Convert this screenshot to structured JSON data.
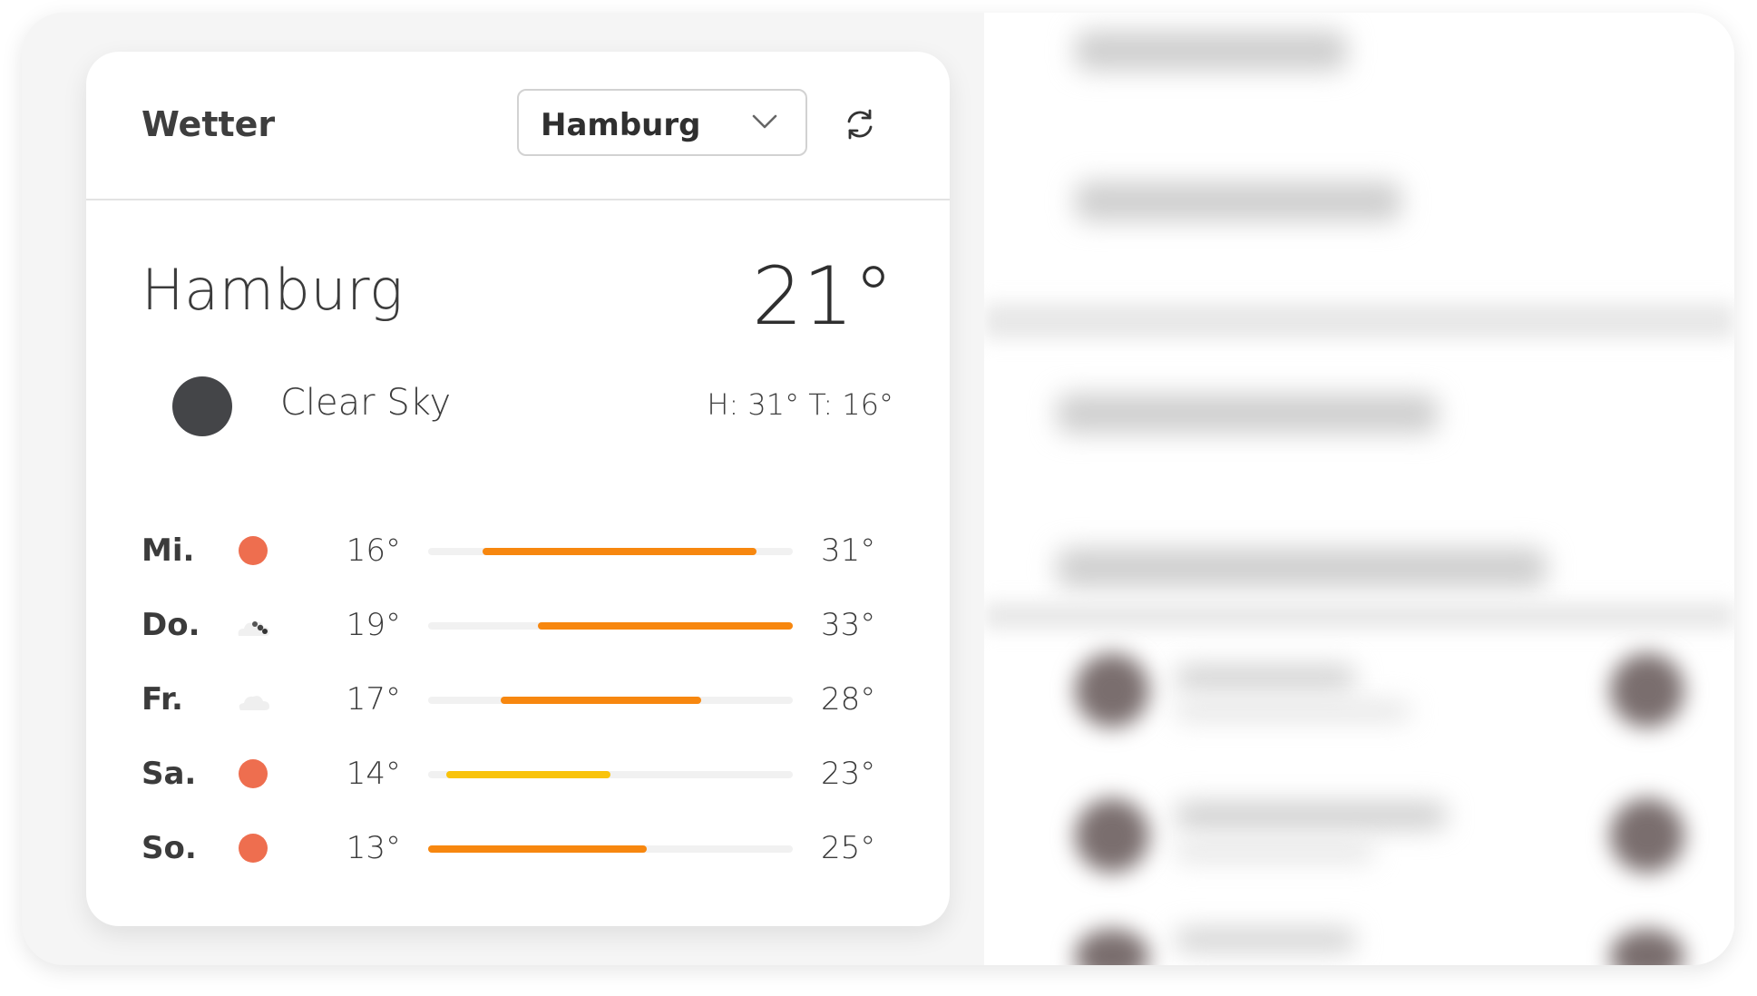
{
  "card": {
    "title": "Wetter",
    "select": {
      "value": "Hamburg"
    },
    "icons": {
      "dropdown": "chevron-down-icon",
      "refresh": "refresh-icon"
    }
  },
  "current": {
    "city": "Hamburg",
    "temperature": "21°",
    "condition": "Clear Sky",
    "condition_icon": "clear-sky-icon",
    "high_low": "H: 31° T: 16°"
  },
  "forecast": [
    {
      "day": "Mi.",
      "icon": "sun-icon",
      "low": "16°",
      "high": "31°",
      "bar_start": 0.15,
      "bar_end": 0.9,
      "bar_color": "#f7870f"
    },
    {
      "day": "Do.",
      "icon": "cloudy-icon",
      "low": "19°",
      "high": "33°",
      "bar_start": 0.3,
      "bar_end": 1.0,
      "bar_color": "#f7870f"
    },
    {
      "day": "Fr.",
      "icon": "cloud-icon",
      "low": "17°",
      "high": "28°",
      "bar_start": 0.2,
      "bar_end": 0.75,
      "bar_color": "#f7870f"
    },
    {
      "day": "Sa.",
      "icon": "sun-icon",
      "low": "14°",
      "high": "23°",
      "bar_start": 0.05,
      "bar_end": 0.5,
      "bar_color": "#f9c30b"
    },
    {
      "day": "So.",
      "icon": "sun-icon",
      "low": "13°",
      "high": "25°",
      "bar_start": 0.0,
      "bar_end": 0.6,
      "bar_color": "#f7870f"
    }
  ],
  "colors": {
    "accent_orange": "#f7870f",
    "accent_yellow": "#f9c30b",
    "sun": "#ee6e4f"
  }
}
